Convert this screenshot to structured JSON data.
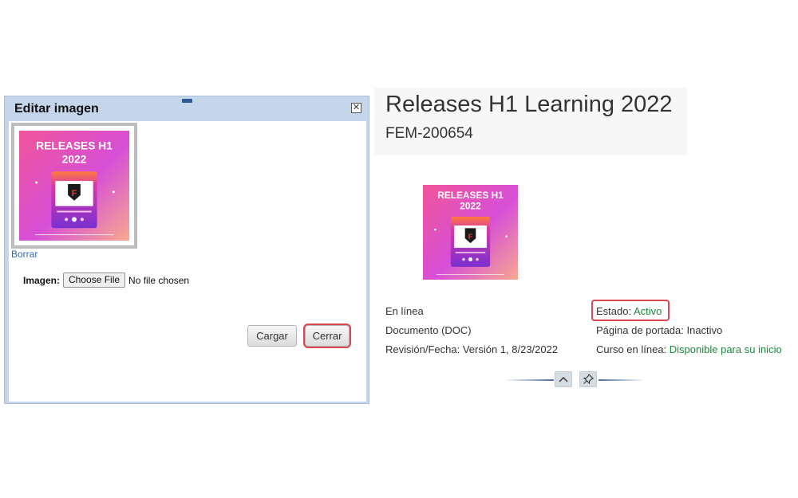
{
  "dialog": {
    "title": "Editar imagen",
    "close_glyph": "✕",
    "delete_link": "Borrar",
    "image_label": "Imagen:",
    "file_button": "Choose File",
    "file_status": "No file chosen",
    "upload_button": "Cargar",
    "close_button": "Cerrar"
  },
  "poster": {
    "line1": "RELEASES H1",
    "line2": "2022",
    "logo_letter": "F"
  },
  "header": {
    "title": "Releases H1 Learning 2022",
    "id": "FEM-200654"
  },
  "details": {
    "left": [
      "En línea",
      "Documento (DOC)",
      "Revisión/Fecha: Versión 1, 8/23/2022"
    ],
    "estado_label": "Estado: ",
    "estado_value": "Activo",
    "portada": "Página de portada: Inactivo",
    "curso_label": "Curso en línea: ",
    "curso_value": "Disponible para su inicio"
  },
  "colors": {
    "accent_green": "#1b8a3c",
    "highlight_red": "#d9494f",
    "link_blue": "#2a6cb8",
    "dialog_frame": "#c5d5ea"
  },
  "icons": [
    "close-icon",
    "chevron-up-icon",
    "pin-icon",
    "shield-logo-icon"
  ]
}
